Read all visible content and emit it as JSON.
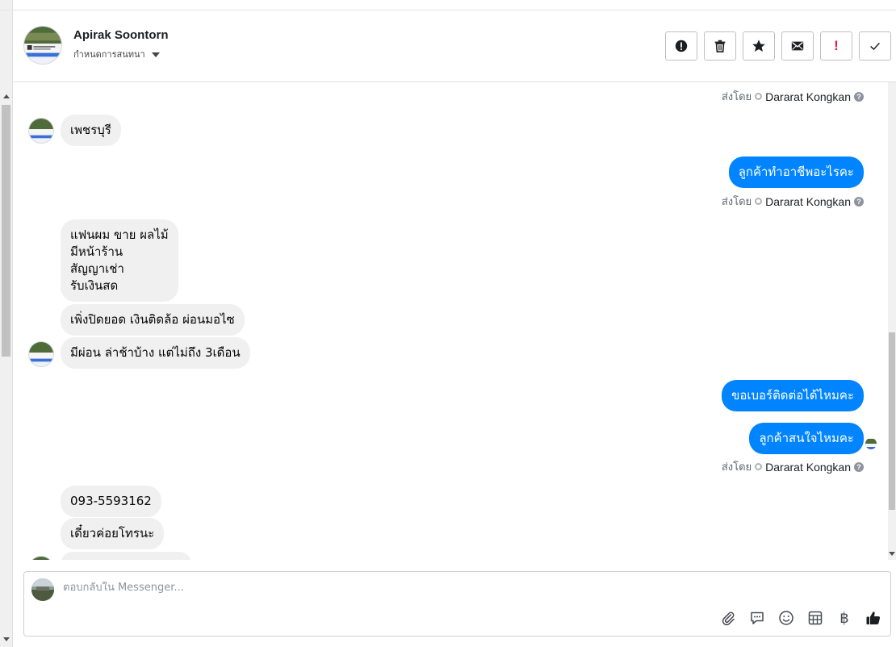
{
  "header": {
    "contact_name": "Apirak Soontorn",
    "assign_label": "กำหนดการสนทนา",
    "actions": [
      {
        "icon": "alert-circle-icon",
        "label": "Spam"
      },
      {
        "icon": "trash-icon",
        "label": "Delete"
      },
      {
        "icon": "star-icon",
        "label": "Follow up"
      },
      {
        "icon": "mail-icon",
        "label": "Mark as unread"
      },
      {
        "icon": "exclamation-icon",
        "label": "!"
      },
      {
        "icon": "check-icon",
        "label": "Done"
      }
    ]
  },
  "thread": {
    "sent_by_label": "ส่งโดย",
    "agent_name": "Dararat Kongkan",
    "help_glyph": "?",
    "messages": [
      {
        "dir": "in",
        "text": "เพชรบุรี"
      },
      {
        "dir": "out",
        "text": "ลูกค้าทำอาชีพอะไรคะ"
      },
      {
        "dir": "in",
        "text": "แฟนผม ขาย ผลไม้\nมีหน้าร้าน\nสัญญาเช่า\nรับเงินสด"
      },
      {
        "dir": "in",
        "text": "เพิ่งปิดยอด เงินติดล้อ ผ่อนมอไซ"
      },
      {
        "dir": "in",
        "text": "มีผ่อน ล่าช้าบ้าง แต่ไม่ถึง 3เดือน"
      },
      {
        "dir": "out",
        "text": "ขอเบอร์ติดต่อได้ไหมคะ"
      },
      {
        "dir": "out",
        "text": "ลูกค้าสนใจไหมคะ"
      },
      {
        "dir": "in",
        "text": "093-5593162"
      },
      {
        "dir": "in",
        "text": "เดี๋ยวค่อยโทรนะ"
      }
    ]
  },
  "composer": {
    "placeholder": "ตอบกลับใน Messenger...",
    "tools": [
      "paperclip-icon",
      "saved-reply-icon",
      "emoji-icon",
      "table-icon",
      "baht-icon",
      "thumbs-up-icon"
    ],
    "baht_glyph": "฿"
  },
  "colors": {
    "outgoing_bubble": "#0084ff",
    "incoming_bubble": "#f0f0f0",
    "danger": "#e41e3f"
  }
}
